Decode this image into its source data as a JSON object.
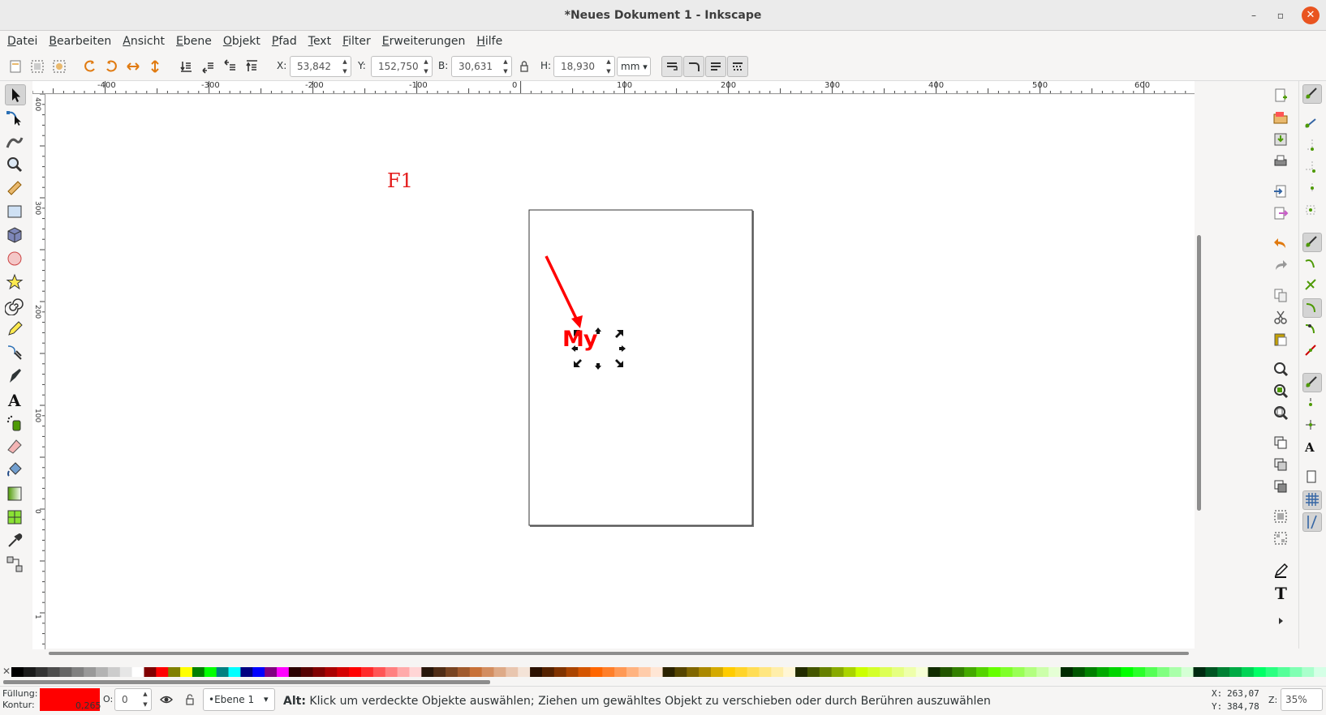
{
  "window": {
    "title": "*Neues Dokument 1 - Inkscape",
    "minimize_icon": "minimize-icon",
    "maximize_icon": "maximize-icon",
    "close_icon": "close-icon",
    "minimize_glyph": "–",
    "maximize_glyph": "▫",
    "close_glyph": "✕"
  },
  "menu": [
    "Datei",
    "Bearbeiten",
    "Ansicht",
    "Ebene",
    "Objekt",
    "Pfad",
    "Text",
    "Filter",
    "Erweiterungen",
    "Hilfe"
  ],
  "toolbar": {
    "x_label": "X:",
    "x_value": "53,842",
    "y_label": "Y:",
    "y_value": "152,750",
    "w_label": "B:",
    "w_value": "30,631",
    "h_label": "H:",
    "h_value": "18,930",
    "unit": "mm",
    "spin_up": "▲",
    "spin_down": "▼",
    "dropdown_arrow": "▾"
  },
  "rulers": {
    "horizontal": [
      "-400",
      "-300",
      "-200",
      "-100",
      "0",
      "100",
      "200",
      "300",
      "400",
      "500",
      "600"
    ],
    "vertical": [
      "400",
      "300",
      "200",
      "100",
      "0",
      "1"
    ]
  },
  "canvas": {
    "page_label": "F1",
    "selected_text": "My",
    "colors": {
      "page_label": "#e41b1b",
      "arrow": "#ff0000",
      "text_fill": "#ff0000"
    }
  },
  "status": {
    "fill_label": "Füllung:",
    "stroke_label": "Kontur:",
    "stroke_width": "0,265",
    "opacity_label": "O:",
    "opacity_value": "0",
    "layer_name": "•Ebene 1",
    "message_bold": "Alt:",
    "message": " Klick um verdeckte Objekte auswählen; Ziehen um gewähltes Objekt zu verschieben oder durch Berühren auszuwählen",
    "cursor_x_label": "X:",
    "cursor_x": "263,07",
    "cursor_y_label": "Y:",
    "cursor_y": "384,78",
    "zoom_label": "Z:",
    "zoom_value": "35%",
    "fill_color": "#ff0000"
  },
  "palette_none_glyph": "✕"
}
